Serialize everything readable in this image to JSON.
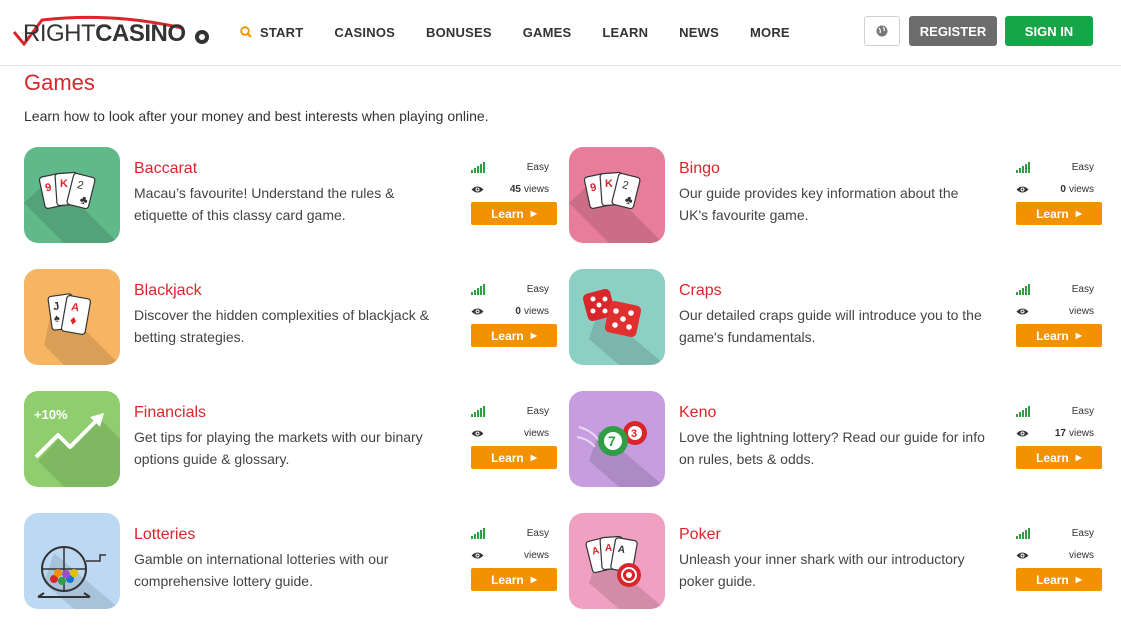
{
  "brand": {
    "logo_part1": "RIGHT",
    "logo_part2": "CASINO",
    "accent": "#d9262b",
    "learn_color": "#f39200",
    "signin_color": "#17a54a",
    "register_color": "#6c6c6c"
  },
  "nav": {
    "items": [
      {
        "label": "START",
        "icon": "search-icon"
      },
      {
        "label": "CASINOS"
      },
      {
        "label": "BONUSES"
      },
      {
        "label": "GAMES"
      },
      {
        "label": "LEARN"
      },
      {
        "label": "NEWS"
      },
      {
        "label": "MORE"
      }
    ],
    "globe_icon": "globe-icon",
    "register_label": "REGISTER",
    "signin_label": "SIGN IN"
  },
  "page": {
    "title": "Games",
    "intro": "Learn how to look after your money and best interests when playing online."
  },
  "games": [
    {
      "title": "Baccarat",
      "desc": "Macau’s favourite! Understand the rules & etiquette of this classy card game.",
      "level": "Easy",
      "views_count": "45",
      "views_label": "views",
      "learn": "Learn",
      "icon": "cards-icon",
      "bg": "#5fb98a"
    },
    {
      "title": "Bingo",
      "desc": "Our guide provides key information about the UK's favourite game.",
      "level": "Easy",
      "views_count": "0",
      "views_label": "views",
      "learn": "Learn",
      "icon": "cards-icon",
      "bg": "#e87d9a"
    },
    {
      "title": "Blackjack",
      "desc": "Discover the hidden complexities of blackjack & betting strategies.",
      "level": "Easy",
      "views_count": "0",
      "views_label": "views",
      "learn": "Learn",
      "icon": "blackjack-cards-icon",
      "bg": "#f7b563"
    },
    {
      "title": "Craps",
      "desc": "Our detailed craps guide will introduce you to the game's fundamentals.",
      "level": "Easy",
      "views_count": "",
      "views_label": "views",
      "learn": "Learn",
      "icon": "dice-icon",
      "bg": "#8ccfc4"
    },
    {
      "title": "Financials",
      "desc": "Get tips for playing the markets with our binary options guide & glossary.",
      "level": "Easy",
      "views_count": "",
      "views_label": "views",
      "learn": "Learn",
      "icon": "trend-up-icon",
      "bg": "#8fcd6e",
      "badge": "+10%"
    },
    {
      "title": "Keno",
      "desc": "Love the lightning lottery? Read our guide for info on rules, bets & odds.",
      "level": "Easy",
      "views_count": "17",
      "views_label": "views",
      "learn": "Learn",
      "icon": "keno-balls-icon",
      "bg": "#c69ee0",
      "ball1": "7",
      "ball2": "3"
    },
    {
      "title": "Lotteries",
      "desc": "Gamble on international lotteries with our comprehensive lottery guide.",
      "level": "Easy",
      "views_count": "",
      "views_label": "views",
      "learn": "Learn",
      "icon": "lottery-drum-icon",
      "bg": "#bcd8f3"
    },
    {
      "title": "Poker",
      "desc": "Unleash your inner shark with our introductory poker guide.",
      "level": "Easy",
      "views_count": "",
      "views_label": "views",
      "learn": "Learn",
      "icon": "poker-cards-icon",
      "bg": "#f0a0c0"
    }
  ]
}
